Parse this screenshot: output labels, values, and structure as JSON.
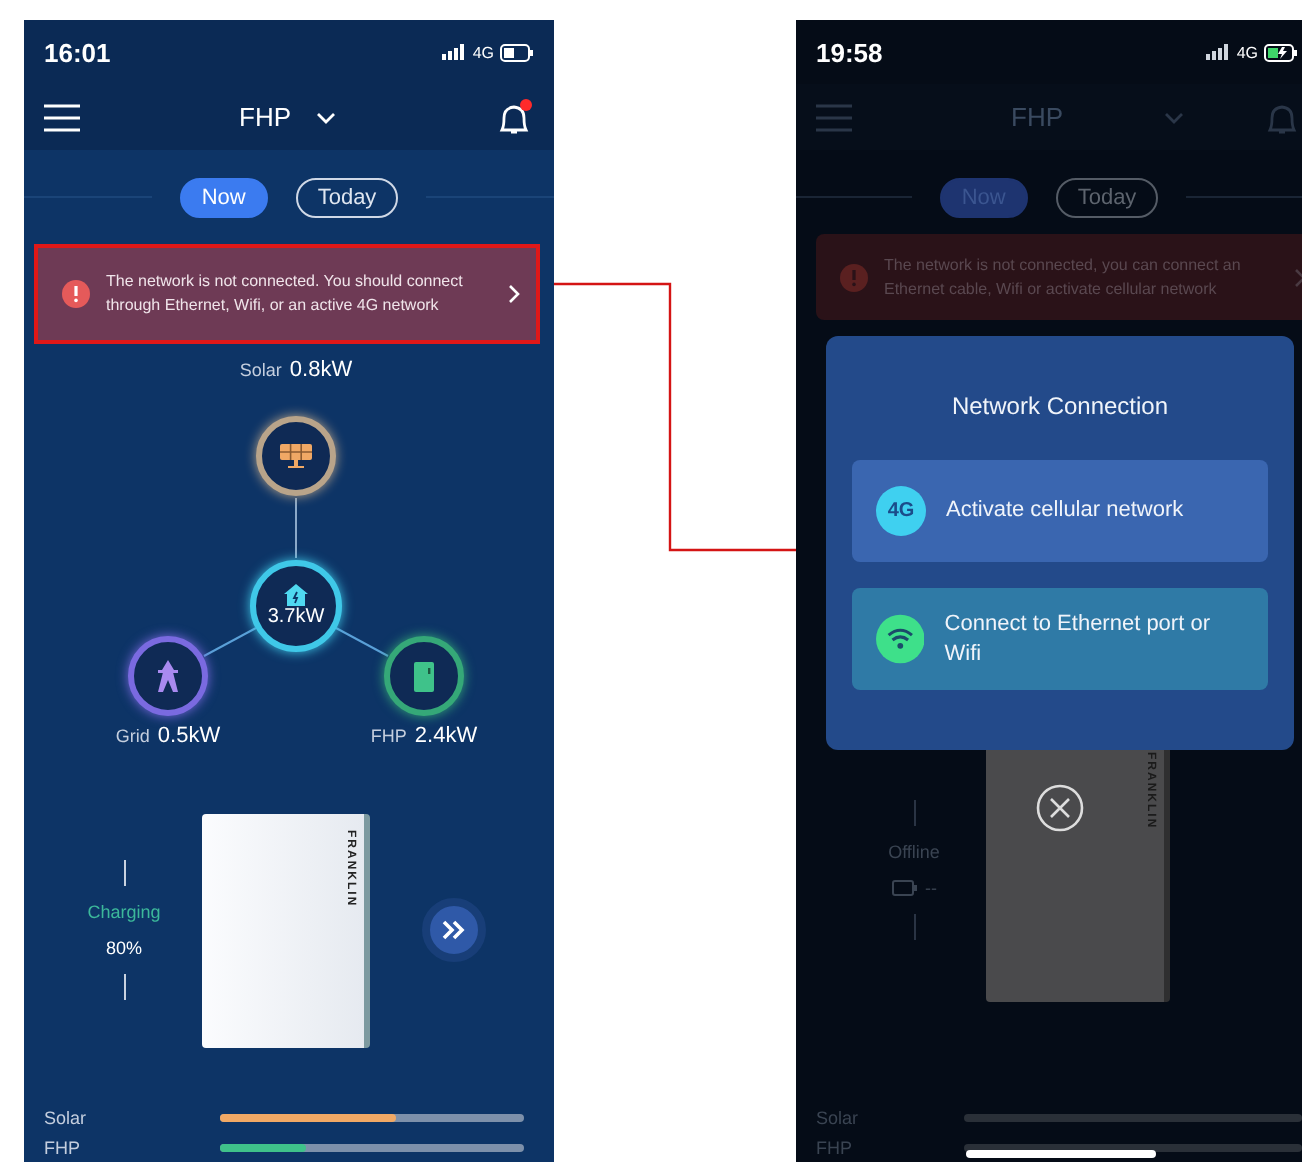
{
  "home_screen": {
    "status_bar": {
      "time": "16:01",
      "network": "4G",
      "charging": false
    },
    "header": {
      "title": "FHP"
    },
    "tabs": [
      {
        "label": "Now",
        "selected": true
      },
      {
        "label": "Today",
        "selected": false
      }
    ],
    "alert": {
      "text": "The network is not connected. You should connect through Ethernet, Wifi, or an active 4G network"
    },
    "flow": [
      {
        "kind": "solar",
        "label": "Solar",
        "value": "0.8kW"
      },
      {
        "kind": "home",
        "value": "3.7kW"
      },
      {
        "kind": "grid",
        "label": "Grid",
        "value": "0.5kW"
      },
      {
        "kind": "fhp",
        "label": "FHP",
        "value": "2.4kW"
      }
    ],
    "device": {
      "online": true,
      "status": "Charging",
      "reading": "80%",
      "brand": "FRANKLIN"
    },
    "bars": [
      {
        "label": "Solar",
        "level": 0.58,
        "color": "#f0a865"
      },
      {
        "label": "FHP",
        "level": 0.28,
        "color": "#3fc28a"
      }
    ]
  },
  "popup_screen": {
    "status_bar": {
      "time": "19:58",
      "network": "4G",
      "charging": true
    },
    "header": {
      "title": "FHP"
    },
    "tabs": [
      {
        "label": "Now",
        "selected": true
      },
      {
        "label": "Today",
        "selected": false
      }
    ],
    "alert": {
      "text": "The network is not connected, you can connect an Ethernet cable, Wifi or activate cellular network"
    },
    "dialog": {
      "title": "Network Connection",
      "options": [
        {
          "kind": "cellular",
          "icon_text": "4G",
          "label": "Activate cellular network"
        },
        {
          "kind": "wifi",
          "label": "Connect to Ethernet port or Wifi"
        }
      ]
    },
    "device": {
      "online": false,
      "status": "Offline",
      "reading": "--",
      "brand": "FRANKLIN"
    },
    "bars": [
      {
        "label": "Solar"
      },
      {
        "label": "FHP"
      }
    ]
  }
}
